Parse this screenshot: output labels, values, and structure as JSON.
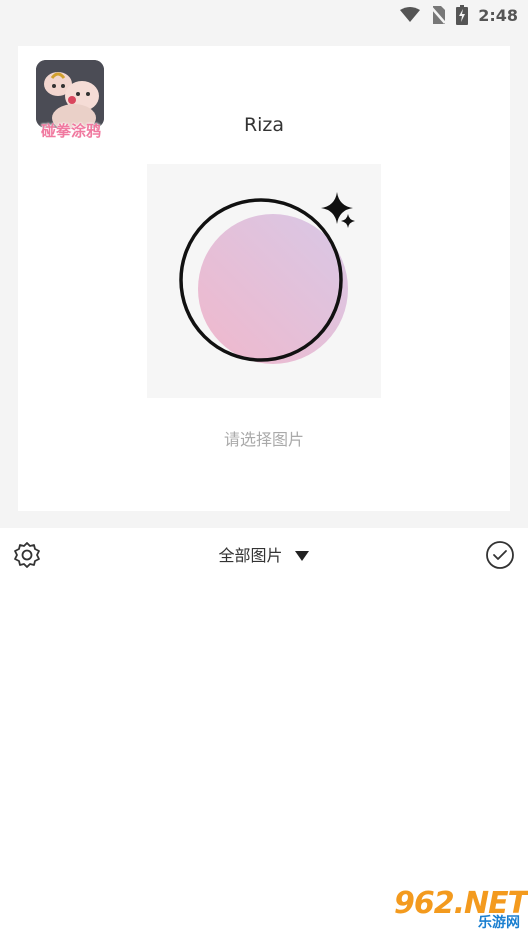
{
  "status_bar": {
    "time": "2:48",
    "icons": [
      "wifi-icon",
      "no-sim-icon",
      "battery-charging-icon"
    ]
  },
  "profile": {
    "app_icon_label": "碰拳涂鸦",
    "username": "Riza",
    "select_hint": "请选择图片"
  },
  "toolbar": {
    "album_label": "全部图片",
    "icons": [
      "settings-gear-icon",
      "caret-down-icon",
      "check-circle-icon"
    ]
  },
  "watermark": {
    "main": "962.NET",
    "sub": "乐游网"
  },
  "colors": {
    "background_top": "#f4f4f4",
    "card": "#ffffff",
    "circle_gradient_start": "#f0b8cc",
    "circle_gradient_end": "#d9c8e6"
  }
}
